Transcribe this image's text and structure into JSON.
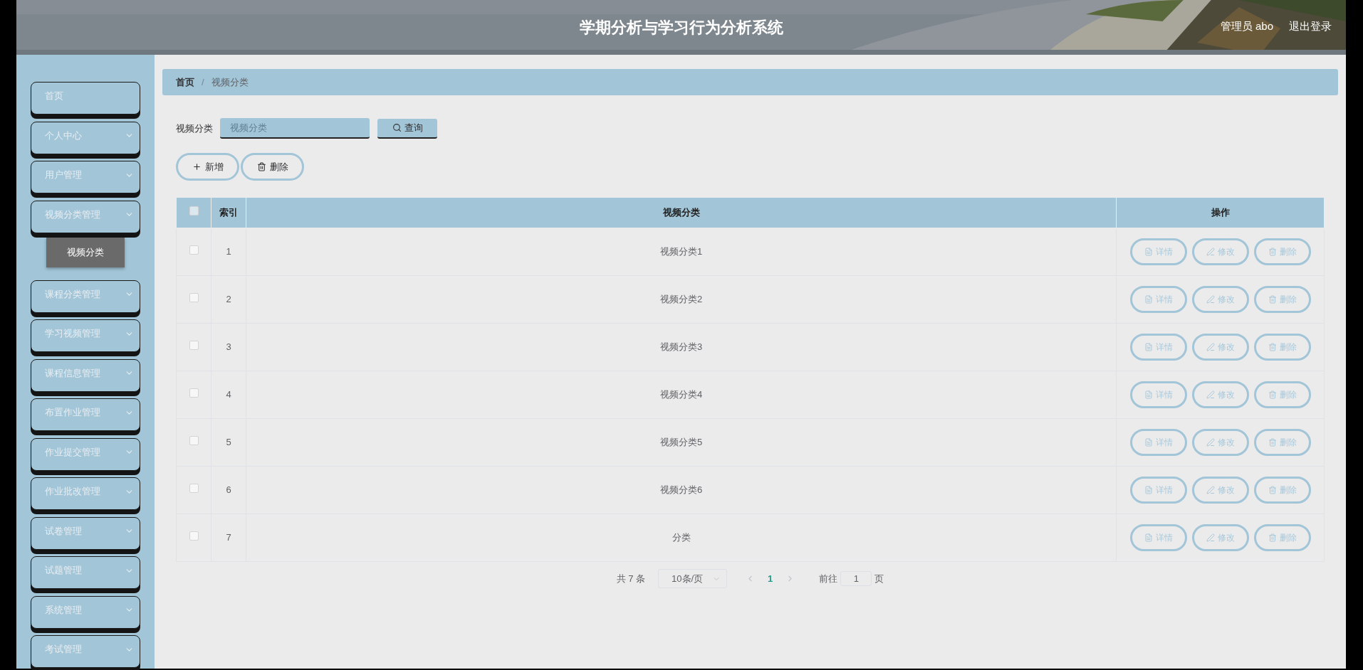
{
  "header": {
    "title": "学期分析与学习行为分析系统",
    "user": "管理员 abo",
    "logout": "退出登录"
  },
  "sidebar": {
    "items": [
      {
        "label": "首页",
        "kind": "link"
      },
      {
        "label": "个人中心",
        "kind": "menu"
      },
      {
        "label": "用户管理",
        "kind": "menu"
      },
      {
        "label": "视频分类管理",
        "kind": "menu",
        "children": [
          {
            "label": "视频分类",
            "selected": true
          }
        ]
      },
      {
        "label": "课程分类管理",
        "kind": "menu"
      },
      {
        "label": "学习视频管理",
        "kind": "menu"
      },
      {
        "label": "课程信息管理",
        "kind": "menu"
      },
      {
        "label": "布置作业管理",
        "kind": "menu"
      },
      {
        "label": "作业提交管理",
        "kind": "menu"
      },
      {
        "label": "作业批改管理",
        "kind": "menu"
      },
      {
        "label": "试卷管理",
        "kind": "menu"
      },
      {
        "label": "试题管理",
        "kind": "menu"
      },
      {
        "label": "系统管理",
        "kind": "menu"
      },
      {
        "label": "考试管理",
        "kind": "menu"
      }
    ]
  },
  "breadcrumb": [
    "首页",
    "视频分类"
  ],
  "breadcrumb_separator": "/",
  "search": {
    "label": "视频分类",
    "placeholder": "视频分类",
    "button": "查询"
  },
  "actions": [
    "新增",
    "删除"
  ],
  "table": {
    "header_checked": false,
    "columns": [
      "索引",
      "视频分类",
      "操作"
    ],
    "rows": [
      {
        "checked": false,
        "index": "1",
        "name": "视频分类1",
        "actions": [
          "详情",
          "修改",
          "删除"
        ]
      },
      {
        "checked": false,
        "index": "2",
        "name": "视频分类2",
        "actions": [
          "详情",
          "修改",
          "删除"
        ]
      },
      {
        "checked": false,
        "index": "3",
        "name": "视频分类3",
        "actions": [
          "详情",
          "修改",
          "删除"
        ]
      },
      {
        "checked": false,
        "index": "4",
        "name": "视频分类4",
        "actions": [
          "详情",
          "修改",
          "删除"
        ]
      },
      {
        "checked": false,
        "index": "5",
        "name": "视频分类5",
        "actions": [
          "详情",
          "修改",
          "删除"
        ]
      },
      {
        "checked": false,
        "index": "6",
        "name": "视频分类6",
        "actions": [
          "详情",
          "修改",
          "删除"
        ]
      },
      {
        "checked": false,
        "index": "7",
        "name": "分类",
        "actions": [
          "详情",
          "修改",
          "删除"
        ]
      }
    ]
  },
  "pagination": {
    "total": "共 7 条",
    "page_size": "10条/页",
    "pages": [
      {
        "label": "1",
        "selected": true
      }
    ],
    "goto": "前往",
    "goto_value": "1",
    "goto_suffix": "页"
  }
}
